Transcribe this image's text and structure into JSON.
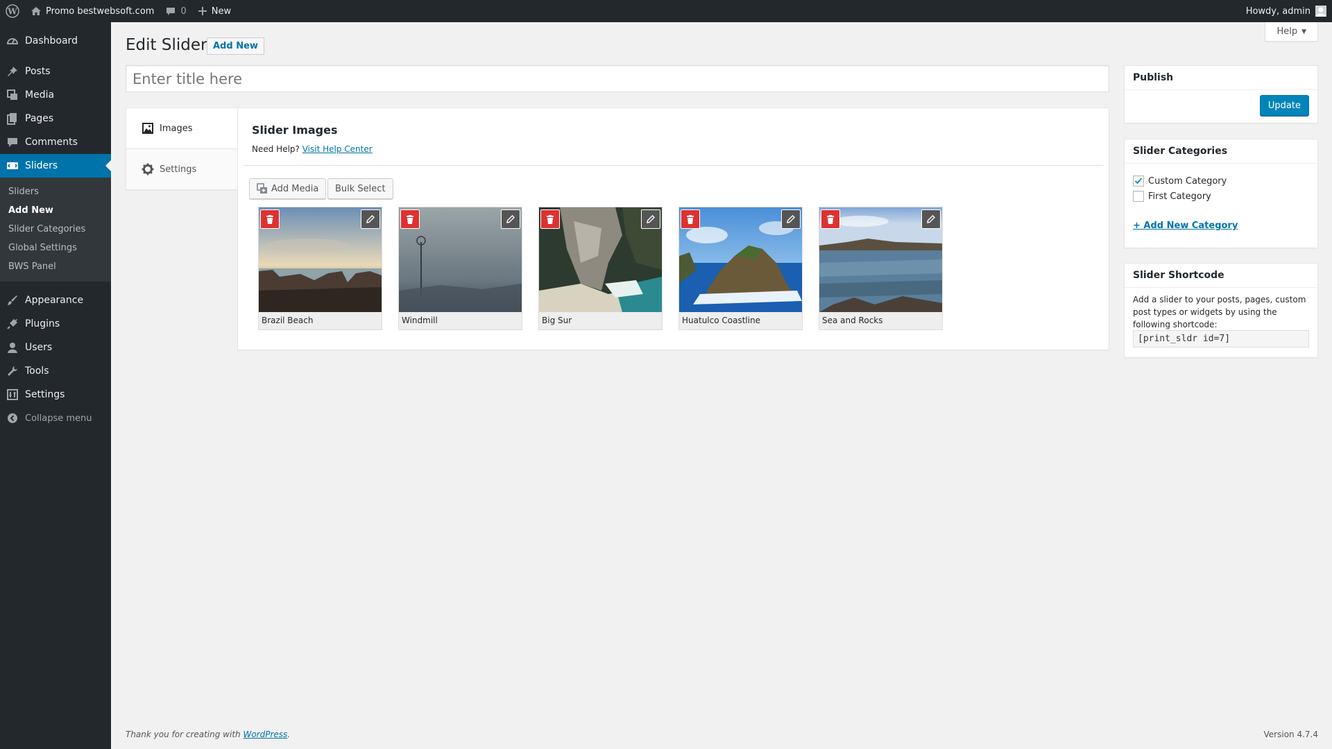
{
  "adminbar": {
    "site_name": "Promo bestwebsoft.com",
    "comments_count": "0",
    "new_label": "New",
    "howdy": "Howdy, admin"
  },
  "menu": {
    "dashboard": "Dashboard",
    "posts": "Posts",
    "media": "Media",
    "pages": "Pages",
    "comments": "Comments",
    "sliders": "Sliders",
    "sliders_sub": [
      "Sliders",
      "Add New",
      "Slider Categories",
      "Global Settings",
      "BWS Panel"
    ],
    "appearance": "Appearance",
    "plugins": "Plugins",
    "users": "Users",
    "tools": "Tools",
    "settings": "Settings",
    "collapse": "Collapse menu"
  },
  "help_tab": "Help",
  "page": {
    "title": "Edit Slider",
    "add_new": "Add New",
    "title_placeholder": "Enter title here"
  },
  "slider_box": {
    "tabs": [
      "Images",
      "Settings"
    ],
    "heading": "Slider Images",
    "need_help": "Need Help?",
    "help_link": "Visit Help Center",
    "add_media": "Add Media",
    "bulk_select": "Bulk Select",
    "images": [
      {
        "caption": "Brazil Beach"
      },
      {
        "caption": "Windmill"
      },
      {
        "caption": "Big Sur"
      },
      {
        "caption": "Huatulco Coastline"
      },
      {
        "caption": "Sea and Rocks"
      }
    ]
  },
  "publish": {
    "heading": "Publish",
    "update": "Update"
  },
  "categories": {
    "heading": "Slider Categories",
    "items": [
      {
        "label": "Custom Category",
        "checked": true
      },
      {
        "label": "First Category",
        "checked": false
      }
    ],
    "add_new": "+ Add New Category"
  },
  "shortcode": {
    "heading": "Slider Shortcode",
    "description": "Add a slider to your posts, pages, custom post types or widgets by using the following shortcode:",
    "value": "[print_sldr id=7]"
  },
  "footer": {
    "thanks_prefix": "Thank you for creating with",
    "wordpress": "WordPress",
    "thanks_suffix": ".",
    "version": "Version 4.7.4"
  },
  "colors": {
    "admin_dark": "#23282d",
    "accent_blue": "#0073aa",
    "primary_button": "#0085ba",
    "delete_red": "#dc3232"
  }
}
